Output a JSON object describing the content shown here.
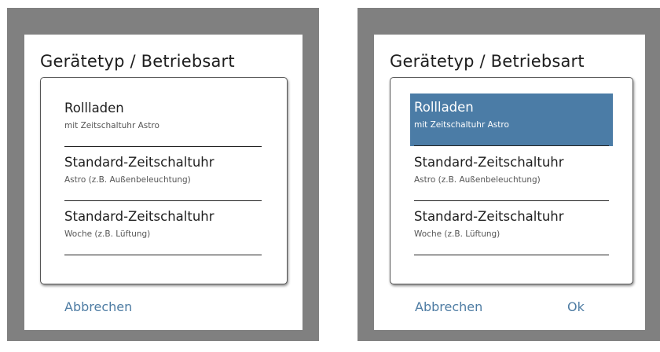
{
  "colors": {
    "frame": "#808080",
    "accent": "#4b7ca6",
    "dialog_bg": "#ffffff",
    "text": "#1e1e1e"
  },
  "left_dialog": {
    "title": "Gerätetyp / Betriebsart",
    "options": [
      {
        "title": "Rollladen",
        "subtitle": "mit Zeitschaltuhr Astro",
        "selected": false
      },
      {
        "title": "Standard-Zeitschaltuhr",
        "subtitle": "Astro (z.B. Außenbeleuchtung)",
        "selected": false
      },
      {
        "title": "Standard-Zeitschaltuhr",
        "subtitle": "Woche (z.B. Lüftung)",
        "selected": false
      }
    ],
    "cancel_label": "Abbrechen"
  },
  "right_dialog": {
    "title": "Gerätetyp / Betriebsart",
    "options": [
      {
        "title": "Rollladen",
        "subtitle": "mit Zeitschaltuhr Astro",
        "selected": true
      },
      {
        "title": "Standard-Zeitschaltuhr",
        "subtitle": "Astro (z.B. Außenbeleuchtung)",
        "selected": false
      },
      {
        "title": "Standard-Zeitschaltuhr",
        "subtitle": "Woche (z.B. Lüftung)",
        "selected": false
      }
    ],
    "cancel_label": "Abbrechen",
    "ok_label": "Ok"
  }
}
